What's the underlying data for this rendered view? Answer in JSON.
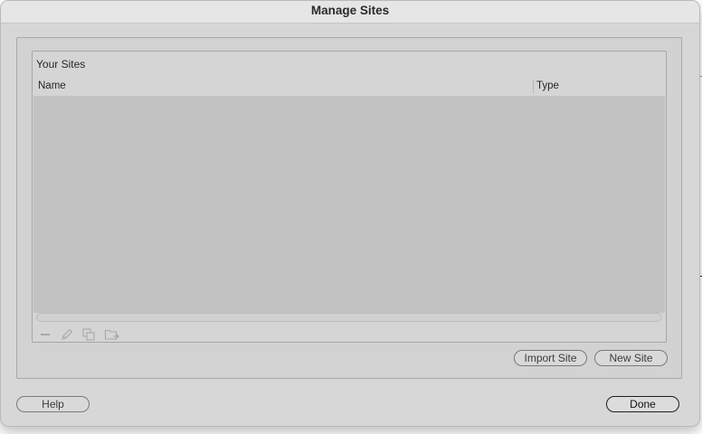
{
  "dialog": {
    "title": "Manage Sites"
  },
  "sites_panel": {
    "group_title": "Your Sites",
    "columns": [
      "Name",
      "Type"
    ],
    "rows": []
  },
  "toolbar": {
    "icons": [
      "minus-icon",
      "pencil-icon",
      "duplicate-icon",
      "export-folder-icon"
    ]
  },
  "buttons": {
    "import_site": "Import Site",
    "new_site": "New Site",
    "help": "Help",
    "done": "Done"
  }
}
